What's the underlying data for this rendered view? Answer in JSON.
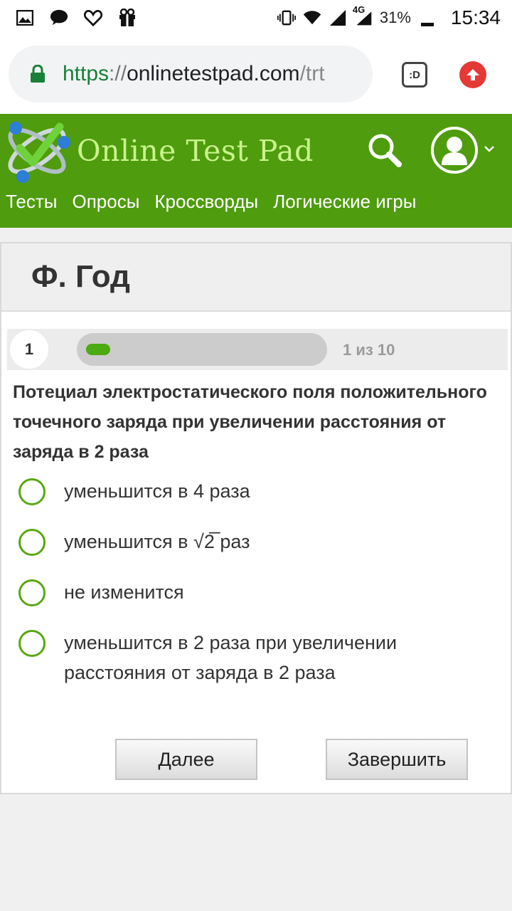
{
  "status_bar": {
    "icons": [
      "gallery-icon",
      "chat-bubble-icon",
      "heart-icon",
      "gift-icon",
      "vibrate-icon",
      "wifi-icon",
      "signal-icon",
      "signal-4g-icon",
      "battery-icon"
    ],
    "network_label": "4G",
    "battery": "31%",
    "time": "15:34"
  },
  "browser": {
    "url_scheme": "https",
    "url_separator": "://",
    "url_host": "onlinetestpad.com",
    "url_path": "/trt",
    "tabs_label": ":D",
    "colors": {
      "secure": "#188038",
      "update": "#e53935"
    }
  },
  "site": {
    "brand": "Online Test Pad",
    "nav": [
      "Тесты",
      "Опросы",
      "Кроссворды",
      "Логические игры"
    ],
    "colors": {
      "header": "#4f9c0e",
      "brand_text": "#c9f48c",
      "accent": "#58a70f"
    }
  },
  "test": {
    "title": "Ф. Год",
    "question_number": "1",
    "progress_text": "1 из 10",
    "progress_fraction": 0.1,
    "question": "Потециал электростатического поля положительного точечного заряда при увеличении расстояния от заряда в 2 раза",
    "options": [
      "уменьшится в 4 раза",
      "уменьшится в √2̅ раз",
      "не изменится",
      "уменьшится в 2 раза при увеличении расстояния от заряда в 2 раза"
    ],
    "next_label": "Далее",
    "finish_label": "Завершить"
  }
}
